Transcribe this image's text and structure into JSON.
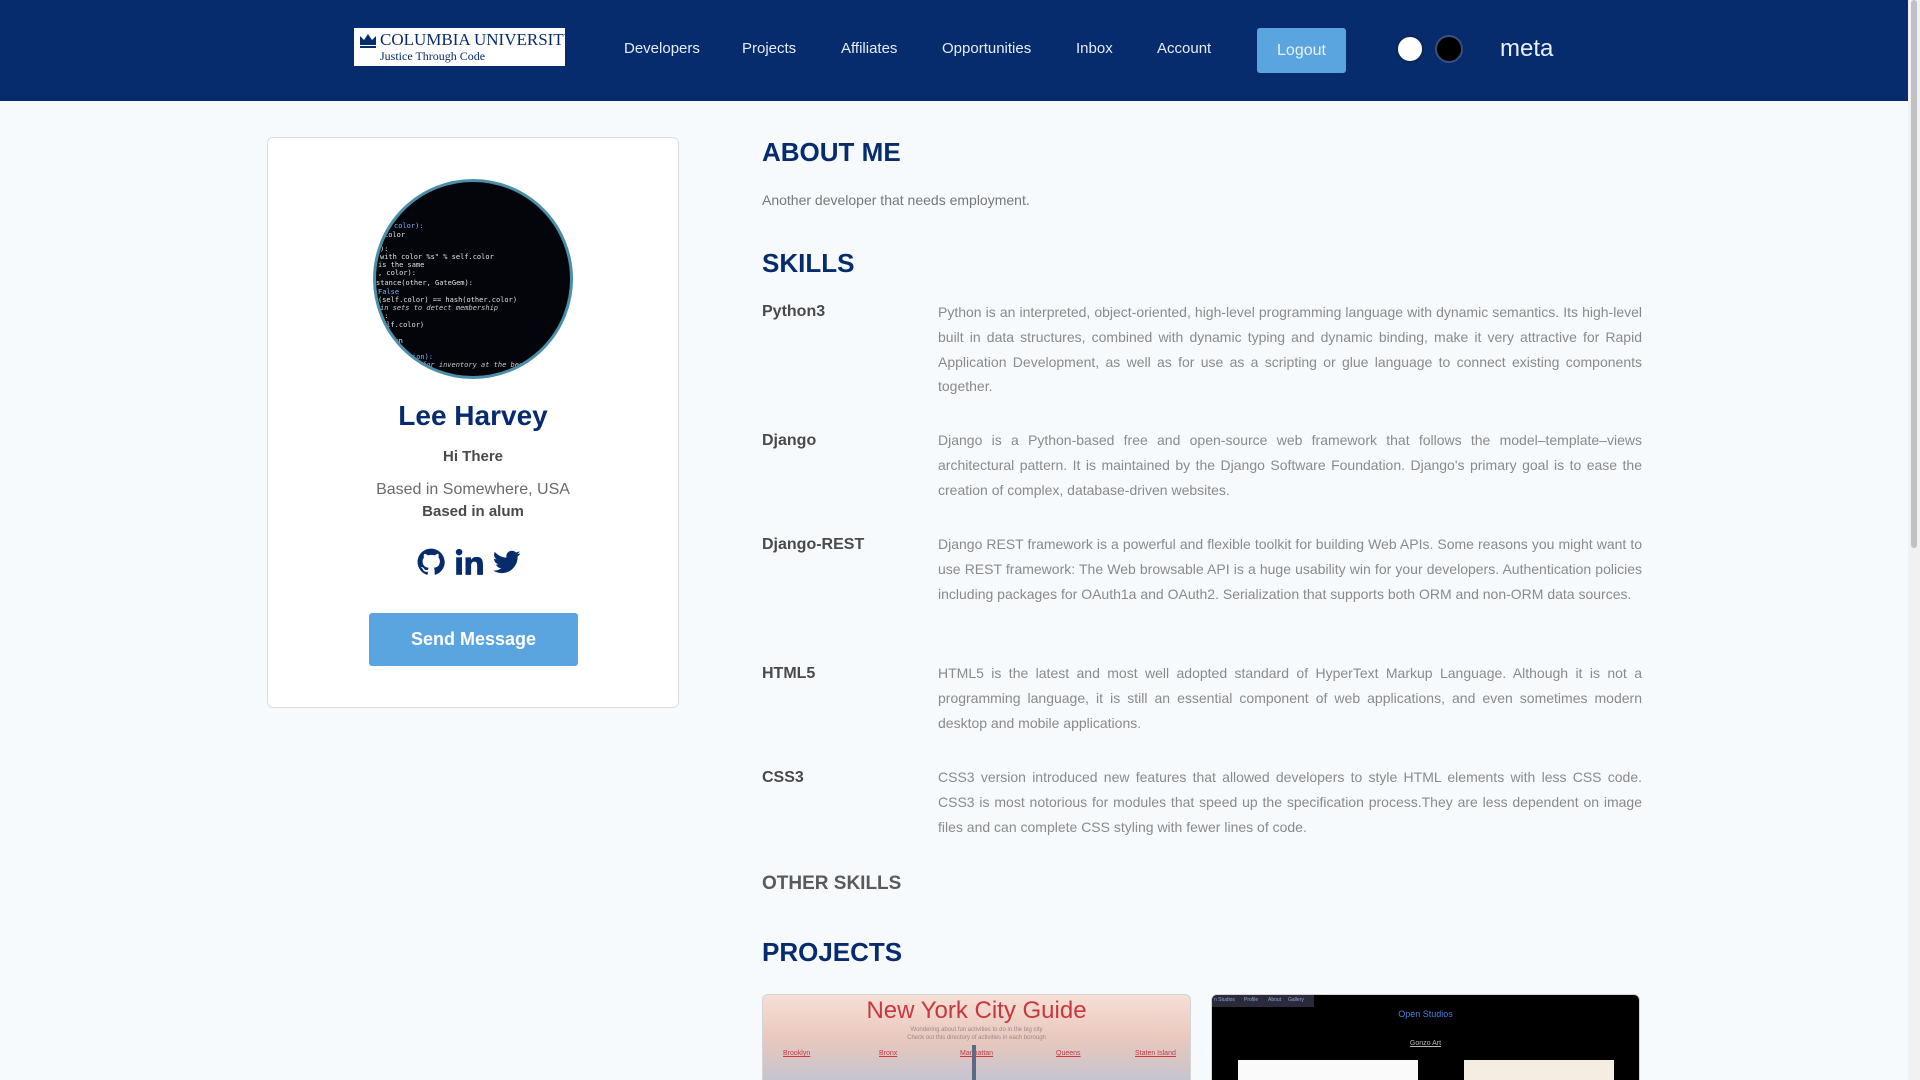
{
  "navbar": {
    "logo": {
      "line1": "COLUMBIA UNIVERSITY",
      "line2": "Justice Through Code"
    },
    "links": [
      "Developers",
      "Projects",
      "Affiliates",
      "Opportunities",
      "Inbox",
      "Account"
    ],
    "logout_label": "Logout",
    "theme_toggles": [
      "light",
      "dark"
    ],
    "brand": "meta",
    "colors": {
      "bar": "#062c6e",
      "button": "#5aa5df"
    }
  },
  "profile": {
    "name": "Lee Harvey",
    "tagline": "Hi There",
    "location": "Based in Somewhere, USA",
    "alum": "Based in alum",
    "socials": [
      "github-icon",
      "linkedin-icon",
      "twitter-icon"
    ],
    "send_label": "Send Message",
    "avatar_code": [
      "color):",
      "color",
      "):",
      " with color %s\" % self.color",
      " is the same",
      ", color):",
      "stance(other, GateGem):",
      " False",
      "(self.color) == hash(other.color)",
      " in sets to detect membership",
      "):",
      "elf.color)",
      "tion",
      "ion):",
      " for inventory at the begin"
    ]
  },
  "about": {
    "heading": "ABOUT ME",
    "text": "Another developer that needs employment."
  },
  "skills": {
    "heading": "SKILLS",
    "items": [
      {
        "name": "Python3",
        "desc": "Python is an interpreted, object-oriented, high-level programming language with dynamic semantics. Its high-level built in data structures, combined with dynamic typing and dynamic binding, make it very attractive for Rapid Application Development, as well as for use as a scripting or glue language to connect existing components together."
      },
      {
        "name": "Django",
        "desc": "Django is a Python-based free and open-source web framework that follows the model–template–views architectural pattern. It is maintained by the Django Software Foundation. Django's primary goal is to ease the creation of complex, database-driven websites."
      },
      {
        "name": "Django-REST",
        "desc": "Django REST framework is a powerful and flexible toolkit for building Web APIs. Some reasons you might want to use REST framework: The Web browsable API is a huge usability win for your developers. Authentication policies including packages for OAuth1a and OAuth2. Serialization that supports both ORM and non-ORM data sources."
      },
      {
        "name": "HTML5",
        "desc": "HTML5 is the latest and most well adopted standard of HyperText Markup Language. Although it is not a programming language, it is still an essential component of web applications, and even sometimes modern desktop and mobile applications."
      },
      {
        "name": "CSS3",
        "desc": "CSS3 version introduced new features that allowed developers to style HTML elements with less CSS code. CSS3 is most notorious for modules that speed up the specification process.They are less dependent on image files and can complete CSS styling with fewer lines of code."
      }
    ]
  },
  "other_skills": {
    "heading": "OTHER SKILLS"
  },
  "projects": {
    "heading": "PROJECTS",
    "nyc": {
      "title": "New York City Guide",
      "sub1": "Wondering about fun activities to do in the big city",
      "sub2": "Check out this directory of activities in each borough",
      "boroughs": [
        "Brooklyn",
        "Bronx",
        "Manhattan",
        "Queens",
        "Staten Island"
      ]
    },
    "open_studios": {
      "nav": [
        "n Studios",
        "Profile",
        "About",
        "Gallery"
      ],
      "title": "Open Studios",
      "artist": "Gonzo Art"
    }
  }
}
